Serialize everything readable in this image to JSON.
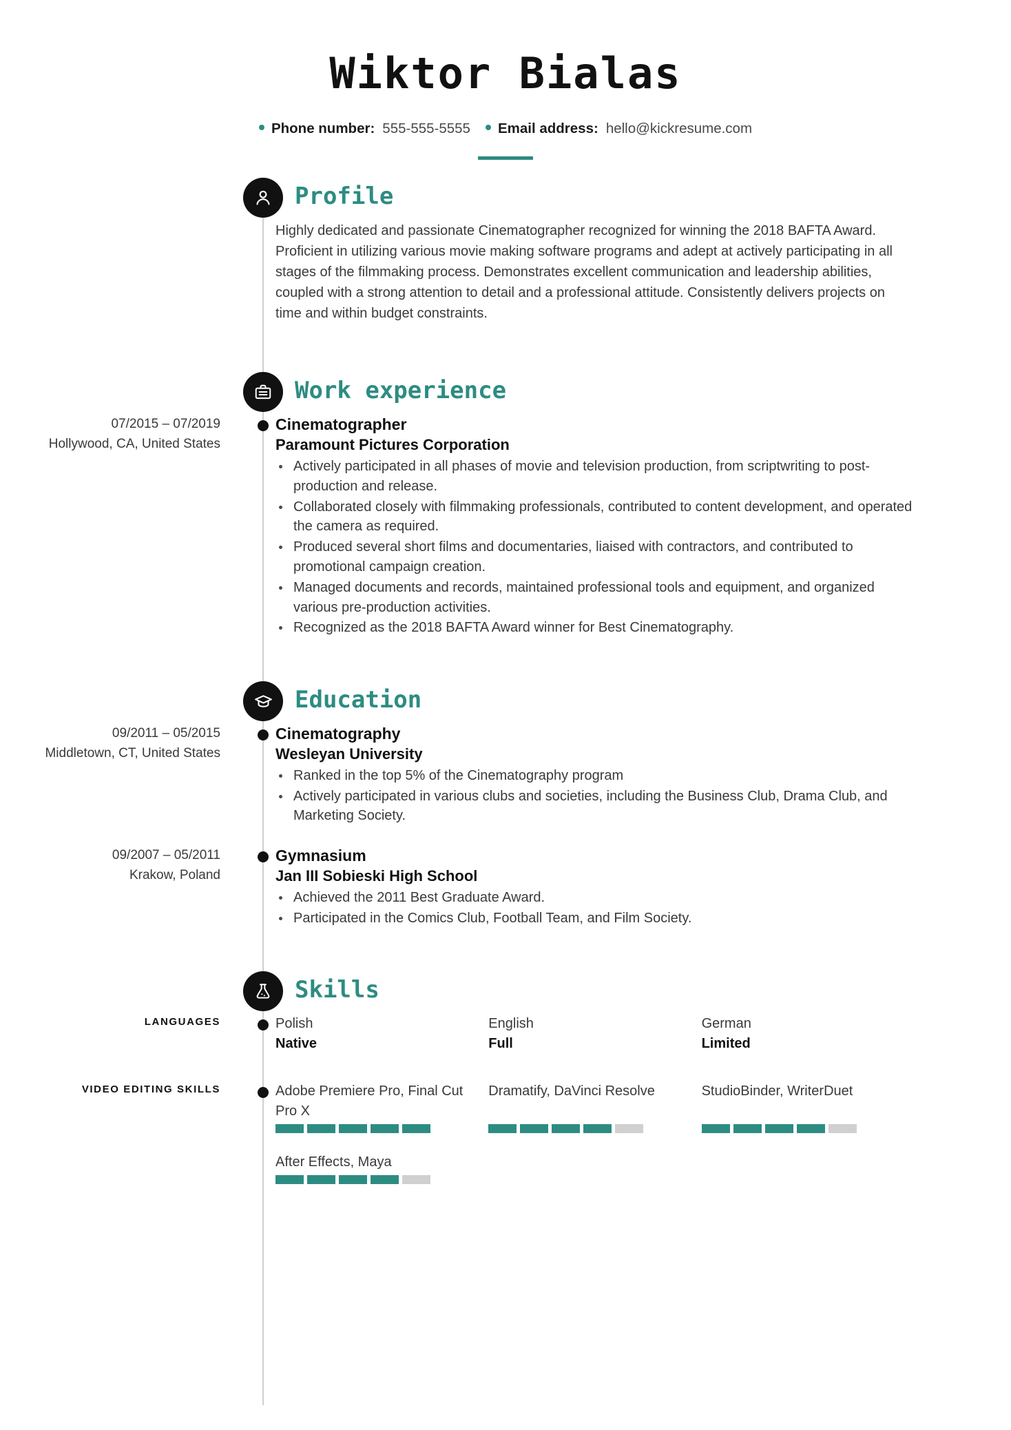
{
  "header": {
    "name": "Wiktor Bialas",
    "contacts": [
      {
        "label": "Phone number:",
        "value": "555-555-5555"
      },
      {
        "label": "Email address:",
        "value": "hello@kickresume.com"
      }
    ]
  },
  "colors": {
    "accent": "#2d8c82",
    "icon_bg": "#111111",
    "rating_empty": "#d0d0d0",
    "timeline": "#cfcfcf"
  },
  "sections": {
    "profile": {
      "title": "Profile",
      "icon": "person-icon",
      "text": "Highly dedicated and passionate Cinematographer recognized for winning the 2018 BAFTA Award. Proficient in utilizing various movie making software programs and adept at actively participating in all stages of the filmmaking process. Demonstrates excellent communication and leadership abilities, coupled with a strong attention to detail and a professional attitude. Consistently delivers projects on time and within budget constraints."
    },
    "work": {
      "title": "Work experience",
      "icon": "briefcase-icon",
      "entries": [
        {
          "date": "07/2015 – 07/2019",
          "location": "Hollywood, CA, United States",
          "title": "Cinematographer",
          "organization": "Paramount Pictures Corporation",
          "bullets": [
            "Actively participated in all phases of movie and television production, from scriptwriting to post-production and release.",
            "Collaborated closely with filmmaking professionals, contributed to content development, and operated the camera as required.",
            "Produced several short films and documentaries, liaised with contractors, and contributed to promotional campaign creation.",
            "Managed documents and records, maintained professional tools and equipment, and organized various pre-production activities.",
            "Recognized as the 2018 BAFTA Award winner for Best Cinematography."
          ]
        }
      ]
    },
    "education": {
      "title": "Education",
      "icon": "graduation-cap-icon",
      "entries": [
        {
          "date": "09/2011 – 05/2015",
          "location": "Middletown, CT, United States",
          "title": "Cinematography",
          "organization": "Wesleyan University",
          "bullets": [
            "Ranked in the top 5% of the Cinematography program",
            "Actively participated in various clubs and societies, including the Business Club, Drama Club, and Marketing Society."
          ]
        },
        {
          "date": "09/2007 – 05/2011",
          "location": "Krakow, Poland",
          "title": "Gymnasium",
          "organization": "Jan III Sobieski High School",
          "bullets": [
            "Achieved the 2011 Best Graduate Award.",
            "Participated in the Comics Club, Football Team, and Film Society."
          ]
        }
      ]
    },
    "skills": {
      "title": "Skills",
      "icon": "flask-icon",
      "languages": {
        "category_label": "Languages",
        "items": [
          {
            "name": "Polish",
            "level": "Native"
          },
          {
            "name": "English",
            "level": "Full"
          },
          {
            "name": "German",
            "level": "Limited"
          }
        ]
      },
      "video_editing": {
        "category_label": "Video editing skills",
        "max_rating": 5,
        "items": [
          {
            "name": "Adobe Premiere Pro, Final Cut Pro X",
            "rating": 5
          },
          {
            "name": "Dramatify, DaVinci Resolve",
            "rating": 4
          },
          {
            "name": "StudioBinder, WriterDuet",
            "rating": 4
          },
          {
            "name": "After Effects, Maya",
            "rating": 4
          }
        ]
      }
    }
  }
}
